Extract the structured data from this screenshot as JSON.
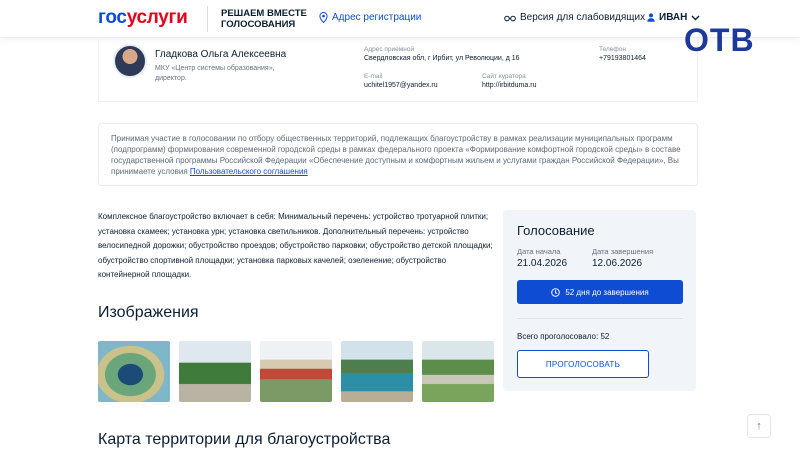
{
  "header": {
    "logo_part1": "гос",
    "logo_part2": "услуги",
    "tagline": "РЕШАЕМ ВМЕСТЕ ГОЛОСОВАНИЯ",
    "address_link": "Адрес регистрации",
    "vision_link": "Версия для слабовидящих",
    "user_name": "ИВАН"
  },
  "watermark": "ОТВ",
  "author": {
    "name": "Гладкова Ольга Алексеевна",
    "org": "МКУ «Центр системы образования», директор.",
    "address_label": "Адрес приемной",
    "address_value": "Свердловская обл, г Ирбит, ул Революции, д 16",
    "phone_label": "Телефон",
    "phone_value": "+79193801464",
    "email_label": "E-mail",
    "email_value": "uchitel1957@yandex.ru",
    "site_label": "Сайт куратора",
    "site_value": "http://irbitduma.ru"
  },
  "agreement": {
    "text": "Принимая участие в голосовании по отбору общественных территорий, подлежащих благоустройству в рамках реализации муниципальных программ (подпрограмм) формирования современной городской среды в рамках федерального проекта «Формирование комфортной городской среды» в составе государственной программы Российской Федерации «Обеспечение доступным и комфортным жильем и услугами граждан Российской Федерации», Вы принимаете условия ",
    "link": "Пользовательского соглашения"
  },
  "description": "Комплексное благоустройство включает в себя: Минимальный перечень: устройство тротуарной плитки; установка скамеек; установка урн; установка светильников. Дополнительный перечень: устройство велосипедной дорожки; обустройство проездов; обустройство парковки; обустройство детской площадки; обустройство спортивной площадки; установка парковых качелей; озеленение; обустройство контейнерной площадки.",
  "images_heading": "Изображения",
  "map_heading": "Карта территории для благоустройства",
  "vote": {
    "title": "Голосование",
    "start_label": "Дата начала",
    "start_value": "21.04.2026",
    "end_label": "Дата завершения",
    "end_value": "12.06.2026",
    "deadline": "52 дня до завершения",
    "total": "Всего проголосовало: 52",
    "button": "ПРОГОЛОСОВАТЬ"
  },
  "scroll_up": "↑",
  "colors": {
    "brand_blue": "#0d4cd3",
    "brand_red": "#e3001b",
    "panel_bg": "#f1f4f8"
  }
}
